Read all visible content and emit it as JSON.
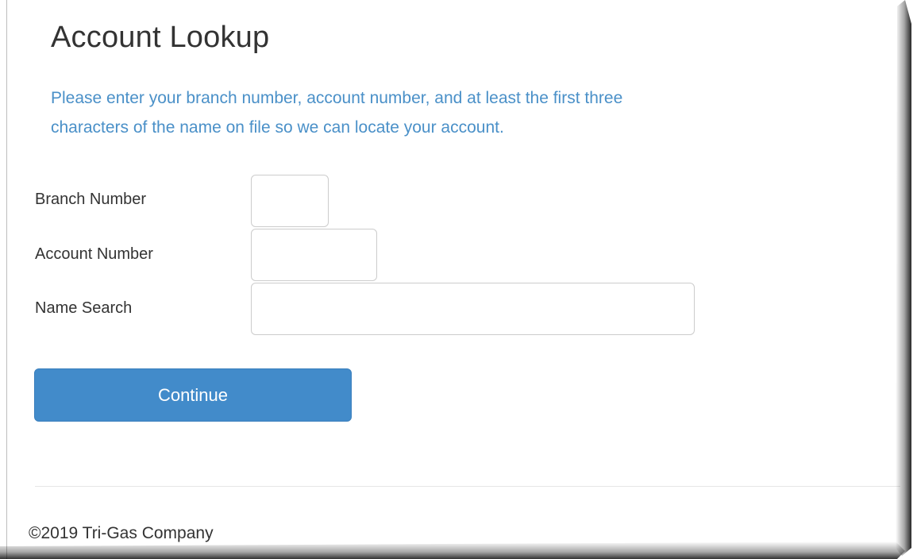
{
  "page": {
    "title": "Account Lookup",
    "intro_line1": "Please enter your branch number, account number, and at least the first three",
    "intro_line2": "characters of the name on file so we can locate your account."
  },
  "form": {
    "branch_label": "Branch Number",
    "branch_value": "",
    "account_label": "Account Number",
    "account_value": "",
    "name_label": "Name Search",
    "name_value": "",
    "continue_label": "Continue"
  },
  "footer": {
    "copyright": "©2019 Tri-Gas Company"
  },
  "colors": {
    "accent": "#428bca",
    "intro_text": "#4a90c8",
    "body_text": "#333333"
  }
}
